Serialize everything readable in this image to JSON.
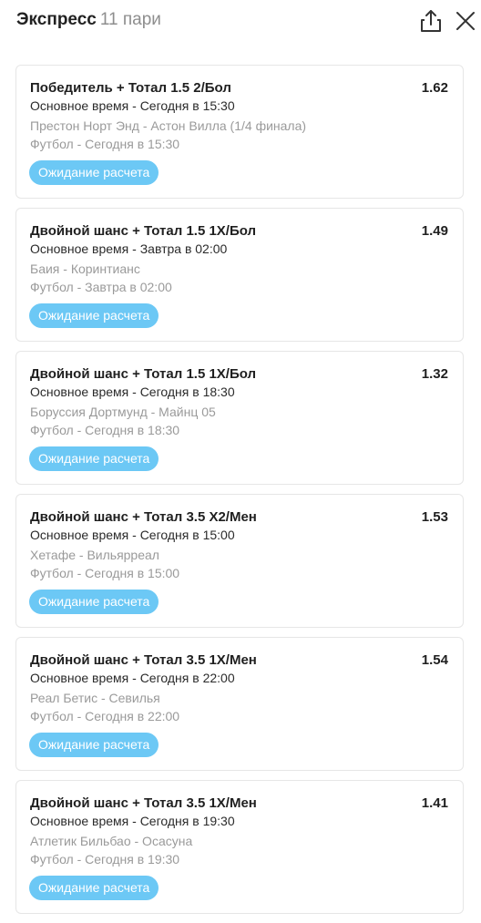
{
  "header": {
    "title": "Экспресс",
    "count": "11 пари",
    "share_icon": "share-icon",
    "close_icon": "close-icon"
  },
  "bets": [
    {
      "market": "Победитель + Тотал 1.5 2/Бол",
      "coef": "1.62",
      "time": "Основное время - Сегодня в 15:30",
      "match": "Престон Норт Энд - Астон Вилла (1/4 финала)",
      "sport": "Футбол - Сегодня в 15:30",
      "status": "Ожидание расчета"
    },
    {
      "market": "Двойной шанс + Тотал 1.5 1Х/Бол",
      "coef": "1.49",
      "time": "Основное время - Завтра в 02:00",
      "match": "Баия - Коринтианс",
      "sport": "Футбол - Завтра в 02:00",
      "status": "Ожидание расчета"
    },
    {
      "market": "Двойной шанс + Тотал 1.5 1Х/Бол",
      "coef": "1.32",
      "time": "Основное время - Сегодня в 18:30",
      "match": "Боруссия Дортмунд - Майнц 05",
      "sport": "Футбол - Сегодня в 18:30",
      "status": "Ожидание расчета"
    },
    {
      "market": "Двойной шанс + Тотал 3.5 Х2/Мен",
      "coef": "1.53",
      "time": "Основное время - Сегодня в 15:00",
      "match": "Хетафе - Вильярреал",
      "sport": "Футбол - Сегодня в 15:00",
      "status": "Ожидание расчета"
    },
    {
      "market": "Двойной шанс + Тотал 3.5 1Х/Мен",
      "coef": "1.54",
      "time": "Основное время - Сегодня в 22:00",
      "match": "Реал Бетис - Севилья",
      "sport": "Футбол - Сегодня в 22:00",
      "status": "Ожидание расчета"
    },
    {
      "market": "Двойной шанс + Тотал 3.5 1Х/Мен",
      "coef": "1.41",
      "time": "Основное время - Сегодня в 19:30",
      "match": "Атлетик Бильбао - Осасуна",
      "sport": "Футбол - Сегодня в 19:30",
      "status": "Ожидание расчета"
    }
  ],
  "colors": {
    "status_bg": "#6cc8f5",
    "muted_text": "#9a9a9a",
    "card_border": "#e6e6e6"
  }
}
